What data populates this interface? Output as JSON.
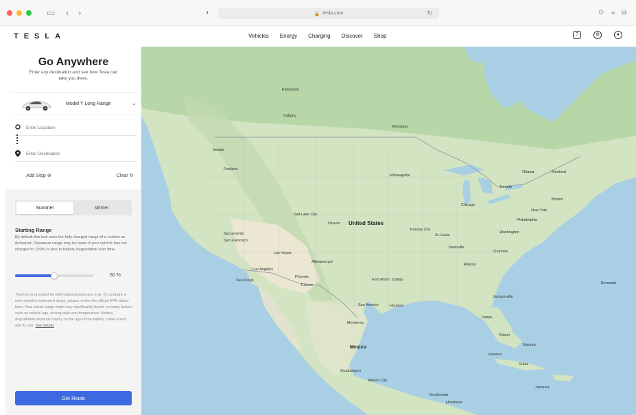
{
  "browser": {
    "url": "tesla.com"
  },
  "header": {
    "logo": "TESLA",
    "nav": [
      "Vehicles",
      "Energy",
      "Charging",
      "Discover",
      "Shop"
    ]
  },
  "sidebar": {
    "title": "Go Anywhere",
    "subtitle": "Enter any destination and see how Tesla can take you there.",
    "vehicle": "Model Y Long Range",
    "location_placeholder": "Enter Location",
    "destination_placeholder": "Enter Destination",
    "add_stop": "Add Stop",
    "clear": "Clear",
    "season": {
      "options": [
        "Summer",
        "Winter"
      ],
      "selected": "Summer"
    },
    "starting_range": {
      "title": "Starting Range",
      "description": "By default this tool uses the fully charged range of a vehicle as delivered. Departure range may be lower if your vehicle has not charged to 100% or due to battery degradation over time.",
      "value_percent": 50,
      "value_label": "50 %"
    },
    "disclaimer": "This tool is provided for informational purposes only. To compare a new vehicle's estimated range, please review the official EPA values here. Your actual range might vary significantly based on many factors such as vehicle age, driving style and temperature. Battery degradation depends mainly on the age of the battery unlike drives and its use.",
    "disclaimer_link": "See details",
    "get_route": "Get Route"
  },
  "map": {
    "country_labels": [
      "United States",
      "Mexico"
    ],
    "city_labels": [
      "Edmonton",
      "Calgary",
      "Winnipeg",
      "Seattle",
      "Portland",
      "Minneapolis",
      "Toronto",
      "Ottawa",
      "Montreal",
      "Chicago",
      "Denver",
      "Salt Lake City",
      "Kansas City",
      "St. Louis",
      "Sacramento",
      "San Francisco",
      "Las Vegas",
      "Los Angeles",
      "San Diego",
      "Phoenix",
      "Tucson",
      "Albuquerque",
      "Fort Worth",
      "Dallas",
      "San Antonio",
      "Houston",
      "Atlanta",
      "Nashville",
      "Charlotte",
      "Washington",
      "Philadelphia",
      "New York",
      "Boston",
      "Jacksonville",
      "Tampa",
      "Miami",
      "Havana",
      "Cuba",
      "Monterrey",
      "Mexico City",
      "Guadalajara",
      "Bermuda",
      "Nassau",
      "Jamaica",
      "Guatemala",
      "Honduras"
    ],
    "colors": {
      "water": "#a9cfe4",
      "land": "#d4e6c4",
      "forest": "#b6d6a6",
      "desert": "#ece8d6",
      "mountain": "#c8dcb4"
    }
  }
}
